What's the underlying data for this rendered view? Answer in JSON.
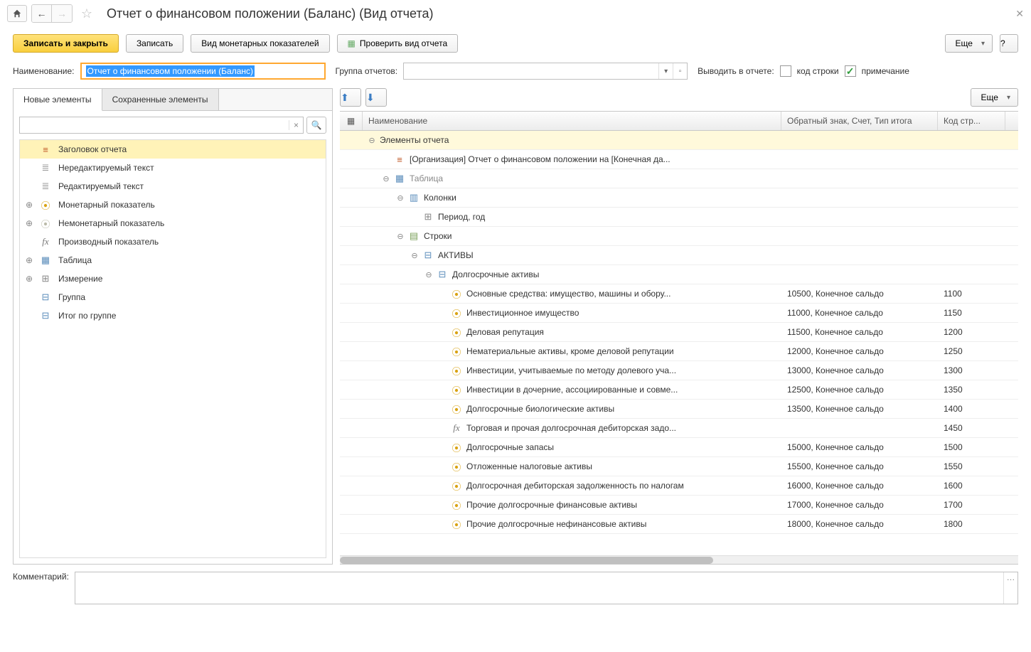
{
  "title": "Отчет о финансовом положении (Баланс) (Вид отчета)",
  "toolbar": {
    "save_close": "Записать и закрыть",
    "save": "Записать",
    "monetary_view": "Вид монетарных показателей",
    "check_report": "Проверить вид отчета",
    "more": "Еще",
    "help": "?"
  },
  "form": {
    "name_label": "Наименование:",
    "name_value": "Отчет о финансовом положении (Баланс)",
    "group_label": "Группа отчетов:",
    "output_label": "Выводить в отчете:",
    "line_code": "код строки",
    "note": "примечание"
  },
  "tabs": {
    "new_elements": "Новые элементы",
    "saved_elements": "Сохраненные элементы"
  },
  "elements": [
    {
      "icon": "head",
      "label": "Заголовок отчета",
      "highlight": true
    },
    {
      "icon": "text-ro",
      "label": "Нередактируемый текст"
    },
    {
      "icon": "text-rw",
      "label": "Редактируемый текст"
    },
    {
      "icon": "coins",
      "label": "Монетарный показатель",
      "expandable": true
    },
    {
      "icon": "coins-off",
      "label": "Немонетарный показатель",
      "expandable": true
    },
    {
      "icon": "fx",
      "label": "Производный показатель"
    },
    {
      "icon": "table",
      "label": "Таблица",
      "expandable": true
    },
    {
      "icon": "grid",
      "label": "Измерение",
      "expandable": true
    },
    {
      "icon": "sum",
      "label": "Группа"
    },
    {
      "icon": "sum2",
      "label": "Итог по группе"
    }
  ],
  "right_toolbar": {
    "more": "Еще"
  },
  "grid_header": {
    "name": "Наименование",
    "sign": "Обратный знак, Счет, Тип итога",
    "code": "Код стр..."
  },
  "grid_rows": [
    {
      "depth": 0,
      "expand": "open",
      "icon": "",
      "label": "Элементы отчета",
      "hl": true
    },
    {
      "depth": 1,
      "icon": "head",
      "label": "[Организация] Отчет о финансовом положении на [Конечная да..."
    },
    {
      "depth": 1,
      "expand": "open",
      "icon": "table",
      "label": "Таблица",
      "gray": true
    },
    {
      "depth": 2,
      "expand": "open",
      "icon": "cols",
      "label": "Колонки"
    },
    {
      "depth": 3,
      "icon": "grid",
      "label": "Период, год"
    },
    {
      "depth": 2,
      "expand": "open",
      "icon": "rows",
      "label": "Строки"
    },
    {
      "depth": 3,
      "expand": "open",
      "icon": "sum",
      "label": "АКТИВЫ"
    },
    {
      "depth": 4,
      "expand": "open",
      "icon": "sum",
      "label": "Долгосрочные активы"
    },
    {
      "depth": 5,
      "icon": "coins",
      "label": "Основные средства: имущество, машины и обору...",
      "sign": "10500, Конечное сальдо",
      "code": "1100"
    },
    {
      "depth": 5,
      "icon": "coins",
      "label": "Инвестиционное имущество",
      "sign": "11000, Конечное сальдо",
      "code": "1150"
    },
    {
      "depth": 5,
      "icon": "coins",
      "label": "Деловая репутация",
      "sign": "11500, Конечное сальдо",
      "code": "1200"
    },
    {
      "depth": 5,
      "icon": "coins",
      "label": "Нематериальные активы, кроме деловой репутации",
      "sign": "12000, Конечное сальдо",
      "code": "1250"
    },
    {
      "depth": 5,
      "icon": "coins",
      "label": "Инвестиции, учитываемые по методу долевого уча...",
      "sign": "13000, Конечное сальдо",
      "code": "1300"
    },
    {
      "depth": 5,
      "icon": "coins",
      "label": "Инвестиции в дочерние, ассоциированные и совме...",
      "sign": "12500, Конечное сальдо",
      "code": "1350"
    },
    {
      "depth": 5,
      "icon": "coins",
      "label": "Долгосрочные биологические активы",
      "sign": "13500, Конечное сальдо",
      "code": "1400"
    },
    {
      "depth": 5,
      "icon": "fx",
      "label": "Торговая и прочая долгосрочная дебиторская задо...",
      "sign": "",
      "code": "1450"
    },
    {
      "depth": 5,
      "icon": "coins",
      "label": "Долгосрочные запасы",
      "sign": "15000, Конечное сальдо",
      "code": "1500"
    },
    {
      "depth": 5,
      "icon": "coins",
      "label": "Отложенные налоговые активы",
      "sign": "15500, Конечное сальдо",
      "code": "1550"
    },
    {
      "depth": 5,
      "icon": "coins",
      "label": "Долгосрочная дебиторская задолженность по налогам",
      "sign": "16000, Конечное сальдо",
      "code": "1600"
    },
    {
      "depth": 5,
      "icon": "coins",
      "label": "Прочие долгосрочные финансовые активы",
      "sign": "17000, Конечное сальдо",
      "code": "1700"
    },
    {
      "depth": 5,
      "icon": "coins",
      "label": "Прочие долгосрочные нефинансовые активы",
      "sign": "18000, Конечное сальдо",
      "code": "1800"
    }
  ],
  "comment": {
    "label": "Комментарий:"
  },
  "icons_svg": {}
}
